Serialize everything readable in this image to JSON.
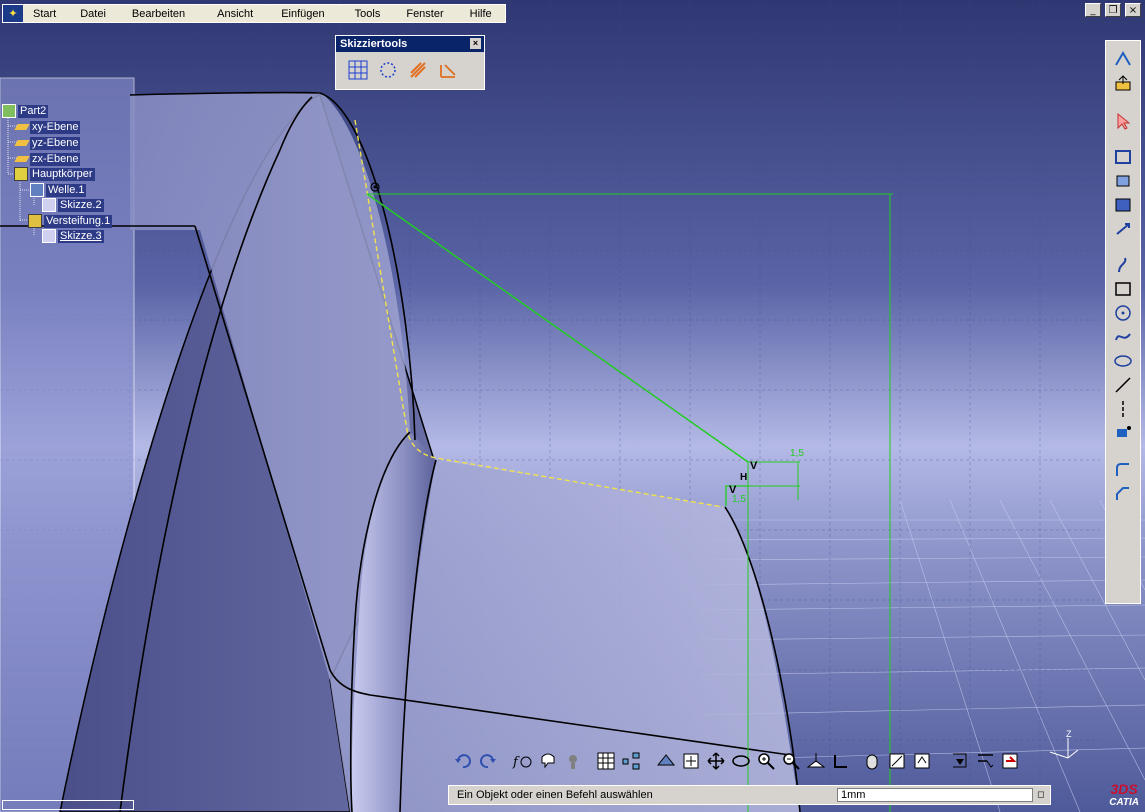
{
  "menubar": {
    "items": [
      "Start",
      "Datei",
      "Bearbeiten",
      "Ansicht",
      "Einfügen",
      "Tools",
      "Fenster",
      "Hilfe"
    ]
  },
  "window_controls": {
    "minimize": "_",
    "restore": "❐",
    "close": "×"
  },
  "sketch_tools": {
    "title": "Skizziertools",
    "close_label": "×",
    "icons": [
      "grid-icon",
      "construction-element-icon",
      "geometric-constraint-icon",
      "dimensional-constraint-icon"
    ]
  },
  "tree": {
    "nodes": [
      {
        "label": "Part2",
        "icon": "part-icon"
      },
      {
        "label": "xy-Ebene",
        "icon": "plane-icon"
      },
      {
        "label": "yz-Ebene",
        "icon": "plane-icon"
      },
      {
        "label": "zx-Ebene",
        "icon": "plane-icon"
      },
      {
        "label": "Hauptkörper",
        "icon": "body-icon"
      },
      {
        "label": "Welle.1",
        "icon": "shaft-icon"
      },
      {
        "label": "Skizze.2",
        "icon": "sketch-icon"
      },
      {
        "label": "Versteifung.1",
        "icon": "stiffener-icon"
      },
      {
        "label": "Skizze.3",
        "icon": "sketch-icon"
      }
    ]
  },
  "viewport": {
    "dimension_labels": [
      "1,5",
      "1,5"
    ],
    "constraint_labels": [
      "V",
      "V",
      "H"
    ]
  },
  "right_toolbar": {
    "icons": [
      "exit-workbench-icon",
      "export-icon",
      "select-arrow-icon",
      "cut-part-icon",
      "profile-icon",
      "rectangle-icon",
      "circle-icon",
      "spline-icon",
      "ellipse-icon",
      "line-icon",
      "axis-icon",
      "point-icon",
      "corner-icon",
      "chamfer-icon",
      "trim-icon",
      "project-3d-icon",
      "analysis-icon"
    ]
  },
  "bottom_toolbar": {
    "icons": [
      "undo-icon",
      "redo-icon",
      "formula-icon",
      "knowledge-icon",
      "spec-icon",
      "table-icon",
      "tree-icon",
      "fly-icon",
      "fit-all-icon",
      "pan-icon",
      "rotate-icon",
      "zoom-in-icon",
      "zoom-out-icon",
      "normal-view-icon",
      "iso-view-icon",
      "shading-icon",
      "hide-show-icon",
      "swap-icon",
      "sketch-view-icon",
      "grid-snap-icon",
      "construction-icon",
      "geometric-constraints-icon"
    ]
  },
  "statusbar": {
    "text": "Ein Objekt oder einen Befehl auswählen",
    "input_value": "1mm"
  },
  "compass_label": "Z",
  "logo": {
    "ds": "3DS",
    "name": "CATIA"
  },
  "colors": {
    "menu_bg": "#ece9d8",
    "toolbar_bg": "#d6d3ce",
    "title_blue": "#0a246a",
    "sketch_green": "#22cc22",
    "highlight_yellow": "#f2e24a"
  }
}
